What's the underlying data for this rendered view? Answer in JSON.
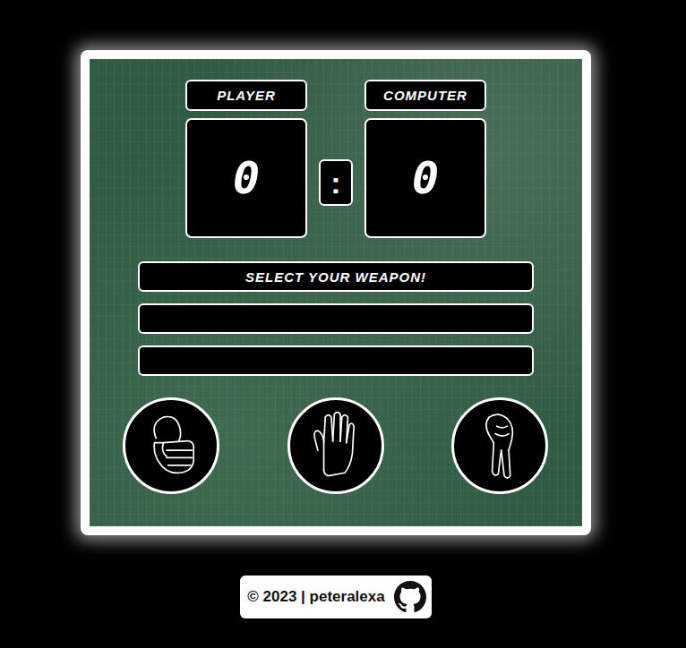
{
  "scoreboard": {
    "player": {
      "label": "PLAYER",
      "score": "0"
    },
    "separator": ":",
    "computer": {
      "label": "COMPUTER",
      "score": "0"
    }
  },
  "messages": [
    "SELECT YOUR WEAPON!",
    "",
    ""
  ],
  "weapons": [
    {
      "kind": "rock"
    },
    {
      "kind": "paper"
    },
    {
      "kind": "scissors"
    }
  ],
  "footer": {
    "text": "© 2023 | peteralexa"
  }
}
